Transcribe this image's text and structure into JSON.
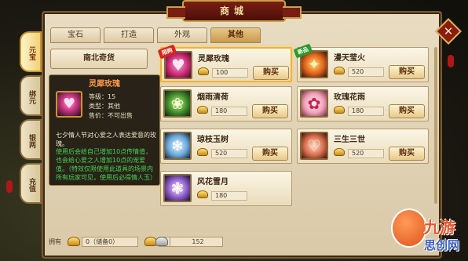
{
  "window": {
    "title": "商城",
    "close_icon": "close-icon"
  },
  "side_nav": [
    {
      "label": "元宝",
      "active": true
    },
    {
      "label": "绑元",
      "active": false
    },
    {
      "label": "银两",
      "active": false
    },
    {
      "label": "充值",
      "active": false
    }
  ],
  "tabs": [
    {
      "label": "宝石",
      "active": false
    },
    {
      "label": "打造",
      "active": false
    },
    {
      "label": "外观",
      "active": false
    },
    {
      "label": "其他",
      "active": true
    }
  ],
  "category": {
    "label": "南北奇货"
  },
  "tooltip": {
    "title": "灵犀玫瑰",
    "level": "等级：15",
    "type": "类型：其他",
    "price": "售价：不可出售",
    "description": "七夕情人节对心爱之人表达爱意的玫瑰。",
    "effect": "使用后会给自己增加10点传情值，也会给心爱之人增加10点的宠爱值。（特效仅限使用此道具的场景内所有玩家可见，使用后必得情人玉）"
  },
  "items": [
    {
      "name": "灵犀玫瑰",
      "price": "100",
      "buy_label": "购买",
      "badge": "限购",
      "icon": "rose-heart-icon",
      "selected": true
    },
    {
      "name": "漫天莹火",
      "price": "520",
      "buy_label": "购买",
      "badge": "新品",
      "icon": "firefly-icon",
      "selected": false
    },
    {
      "name": "烟雨清荷",
      "price": "180",
      "buy_label": "购买",
      "badge": "",
      "icon": "lotus-icon",
      "selected": false
    },
    {
      "name": "玫瑰花雨",
      "price": "180",
      "buy_label": "购买",
      "badge": "",
      "icon": "rose-rain-icon",
      "selected": false
    },
    {
      "name": "琼枝玉树",
      "price": "520",
      "buy_label": "购买",
      "badge": "",
      "icon": "jade-tree-icon",
      "selected": false
    },
    {
      "name": "三生三世",
      "price": "520",
      "buy_label": "购买",
      "badge": "",
      "icon": "heart-swirl-icon",
      "selected": false
    },
    {
      "name": "风花雪月",
      "price": "180",
      "buy_label": "购买",
      "badge": "",
      "icon": "snow-flower-icon",
      "selected": false
    }
  ],
  "bottom_bar": {
    "owned_label": "拥有",
    "yuanbao": "0（储备0）",
    "bound_yuanbao": "0",
    "silver": "152"
  },
  "watermark": {
    "line1": "九游",
    "line2": "思创网"
  },
  "colors": {
    "accent": "#c9962a",
    "title_red": "#7a1e14",
    "tooltip_title": "#ff9a4a",
    "tooltip_green": "#48d456"
  }
}
